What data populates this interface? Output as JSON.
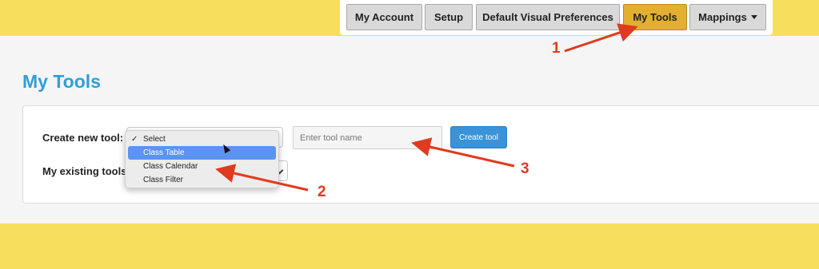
{
  "nav": {
    "items": [
      {
        "label": "My Account"
      },
      {
        "label": "Setup"
      },
      {
        "label": "Default Visual Preferences"
      },
      {
        "label": "My Tools"
      },
      {
        "label": "Mappings"
      }
    ]
  },
  "page": {
    "title": "My Tools"
  },
  "form": {
    "create_label": "Create new tool:",
    "existing_label": "My existing tools:",
    "tool_name_placeholder": "Enter tool name",
    "create_button": "Create tool"
  },
  "dropdown": {
    "selected_marker": "✓",
    "options": [
      "Select",
      "Class Table",
      "Class Calendar",
      "Class Filter"
    ]
  },
  "annotations": [
    "1",
    "2",
    "3"
  ],
  "colors": {
    "accent": "#2f9fd9",
    "active_tab": "#e3af2f",
    "annotation": "#e03a1f",
    "background": "#f7df5e"
  }
}
